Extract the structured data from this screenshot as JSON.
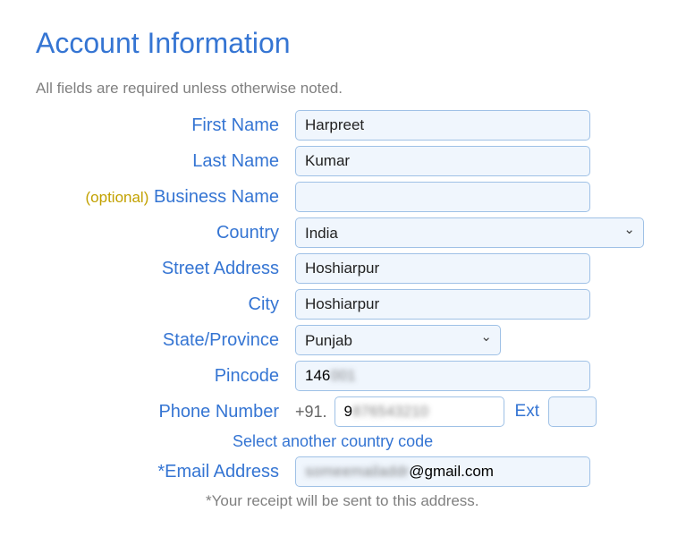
{
  "heading": "Account Information",
  "subtext": "All fields are required unless otherwise noted.",
  "labels": {
    "first_name": "First Name",
    "last_name": "Last Name",
    "business_name": "Business Name",
    "optional": "(optional)",
    "country": "Country",
    "street_address": "Street Address",
    "city": "City",
    "state": "State/Province",
    "pincode": "Pincode",
    "phone": "Phone Number",
    "ext": "Ext",
    "email": "*Email Address"
  },
  "values": {
    "first_name": "Harpreet",
    "last_name": "Kumar",
    "business_name": "",
    "country": "India",
    "street_address": "Hoshiarpur",
    "city": "Hoshiarpur",
    "state": "Punjab",
    "pincode_visible": "146",
    "pincode_blur": "001",
    "phone_prefix": "+91.",
    "phone_visible": "9",
    "phone_blur": "876543210",
    "ext": "",
    "email_blur": "someemailaddr",
    "email_visible": "@gmail.com"
  },
  "link": "Select another country code",
  "footnote": "*Your receipt will be sent to this address."
}
